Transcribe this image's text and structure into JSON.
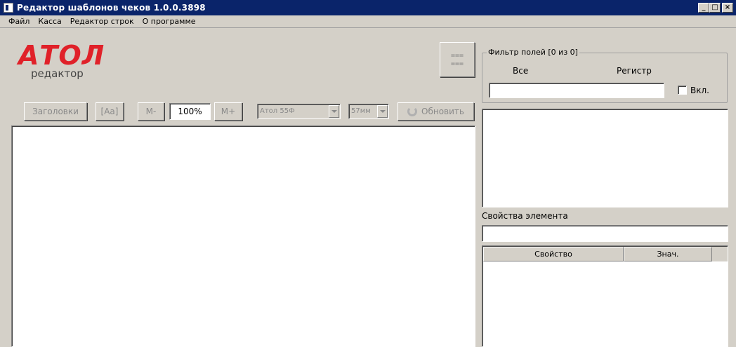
{
  "window": {
    "title": "Редактор шаблонов чеков 1.0.0.3898",
    "controls": [
      "minimize",
      "maximize",
      "close"
    ]
  },
  "menu": {
    "items": [
      "Файл",
      "Касса",
      "Редактор строк",
      "О программе"
    ]
  },
  "logo": {
    "brand": "АТОЛ",
    "subtitle": "редактор"
  },
  "toolbar": {
    "menu_button_icon": "hamburger-icon",
    "menu_button_glyph": "===\n===",
    "headers_label": "Заголовки",
    "font_label": "[Aa]",
    "zoom_out_label": "M-",
    "zoom_value": "100%",
    "zoom_in_label": "M+",
    "device_combo": "Атол 55Ф",
    "paper_combo": "57мм",
    "refresh_label": "Обновить",
    "refresh_icon": "refresh-icon"
  },
  "filter": {
    "title": "Фильтр полей [0 из 0]",
    "all_label": "Все",
    "register_label": "Регистр",
    "input_value": "",
    "enable_label": "Вкл.",
    "enable_checked": false
  },
  "properties": {
    "title": "Свойства элемента",
    "input_value": "",
    "columns": [
      "Свойство",
      "Знач."
    ]
  },
  "colors": {
    "titlebar": "#0a246a",
    "background": "#d4d0c8",
    "logo_red": "#e02129"
  }
}
